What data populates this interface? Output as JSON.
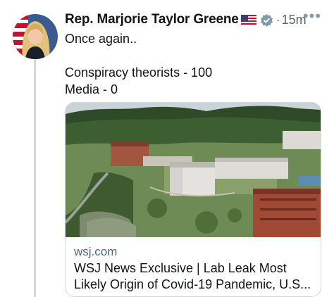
{
  "tweet": {
    "author_name": "Rep. Marjorie Taylor Greene",
    "flag_icon": "us-flag-icon",
    "verified_icon": "verified-badge-icon",
    "separator": "·",
    "timestamp": "15m",
    "more_icon": "more-dots-icon",
    "more_label": "•••",
    "text_lines": [
      "Once again..",
      "",
      "Conspiracy theorists - 100",
      "Media - 0"
    ]
  },
  "link_card": {
    "image": "aerial-photo-of-lab-campus",
    "domain": "wsj.com",
    "title_line1": "WSJ News Exclusive | Lab Leak Most",
    "title_line2": "Likely Origin of Covid-19 Pandemic, U.S..."
  },
  "colors": {
    "text": "#0f1419",
    "secondary_text": "#536471",
    "border": "#cfd9de",
    "verified": "#829aab"
  }
}
